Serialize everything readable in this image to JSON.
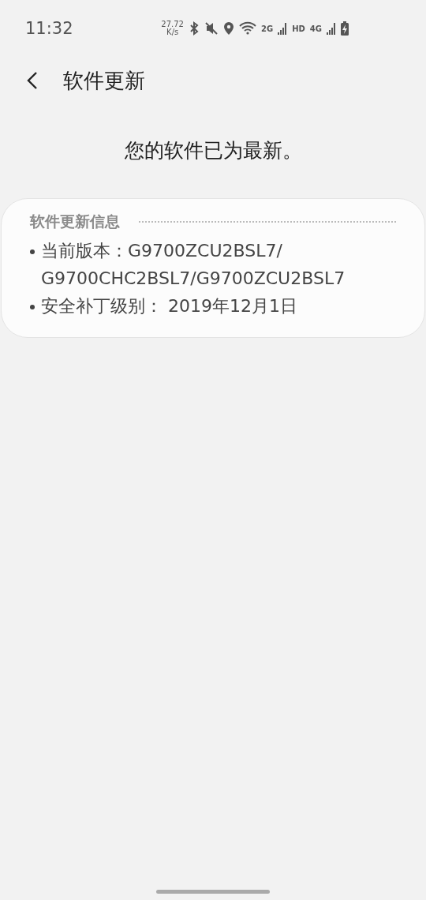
{
  "status_bar": {
    "time": "11:32",
    "net_speed": "27.72",
    "net_unit": "K/s",
    "signal_1": "2G",
    "hd": "HD",
    "signal_2": "4G"
  },
  "header": {
    "title": "软件更新"
  },
  "message": "您的软件已为最新。",
  "info_card": {
    "heading": "软件更新信息",
    "items": [
      "当前版本：G9700ZCU2BSL7/\nG9700CHC2BSL7/G9700ZCU2BSL7",
      "安全补丁级别： 2019年12月1日"
    ]
  }
}
